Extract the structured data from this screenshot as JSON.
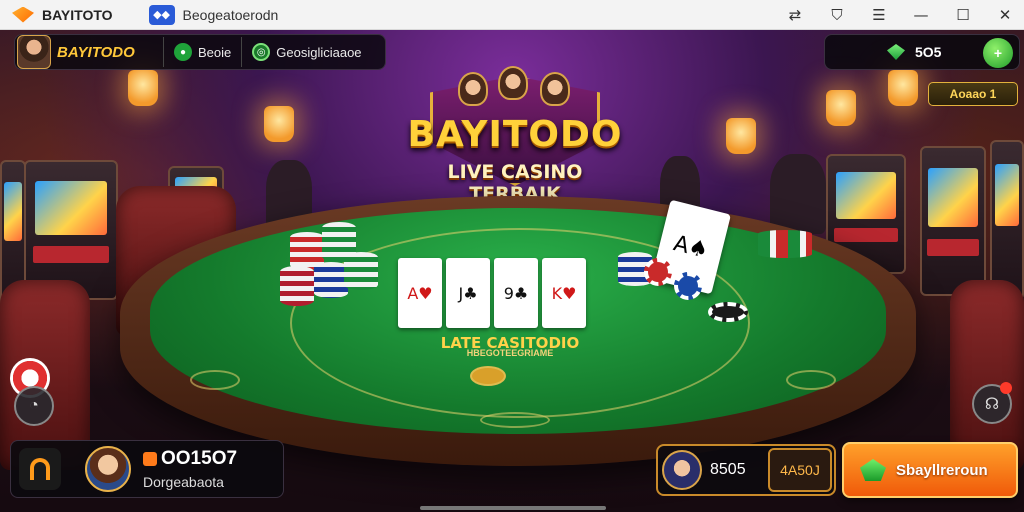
{
  "window": {
    "app_title": "BAYITOTO",
    "tab_title": "Beogeatoerodn",
    "controls": {
      "minimize": "—",
      "maximize": "☐",
      "close": "✕"
    }
  },
  "hud": {
    "brand": "BAYITODO",
    "items": [
      {
        "label": "Beoie",
        "icon": "gamepad-icon",
        "color": "#1fa33a"
      },
      {
        "label": "Geosigliciaaoe",
        "icon": "globe-icon",
        "color": "#1fa33a"
      }
    ],
    "balance": "5O5",
    "currency_icon": "gem-icon",
    "add_button": "+",
    "badge": "Aoaao 1"
  },
  "logo": {
    "title": "BAYITODO",
    "subtitle": "LIVE CASINO TERBAIK"
  },
  "table": {
    "felt_title": "LATE CASITODIO",
    "felt_subtitle": "HBEGOTEEGRIAME",
    "cards": [
      "A♥",
      "J♣",
      "9♣",
      "K♥"
    ],
    "dealt_card": "A♠"
  },
  "player": {
    "balance": "OO15O7",
    "name": "Dorgeabaota"
  },
  "opponent": {
    "value": "8505",
    "badge": "4A50J"
  },
  "play_button": {
    "label": "Sbayllreroun"
  },
  "colors": {
    "accent": "#ffc83a",
    "felt": "#147a2c",
    "play_button": "#f36a10"
  }
}
